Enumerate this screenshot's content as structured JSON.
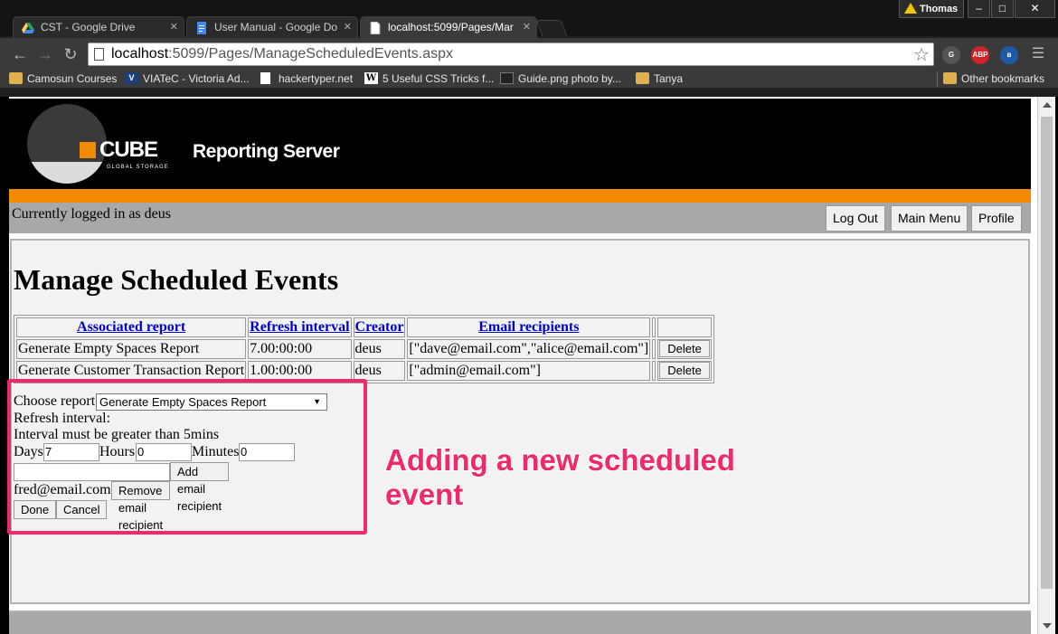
{
  "browser": {
    "tabs": [
      {
        "title": "CST - Google Drive",
        "icon": "google-drive-icon"
      },
      {
        "title": "User Manual - Google Do",
        "icon": "google-docs-icon"
      },
      {
        "title": "localhost:5099/Pages/Mar",
        "icon": "page-icon",
        "active": true
      }
    ],
    "profile_name": "Thomas",
    "window_controls": {
      "minimize": "–",
      "maximize": "□",
      "close": "✕"
    },
    "url_host": "localhost",
    "url_rest": ":5099/Pages/ManageScheduledEvents.aspx",
    "extensions": [
      {
        "name": "ghostery-icon",
        "label": "G",
        "color": "#555555"
      },
      {
        "name": "adblock-plus-icon",
        "label": "ABP",
        "color": "#d2232a"
      },
      {
        "name": "bluetooth-icon",
        "label": "ʙ",
        "color": "#1e5aa8"
      }
    ],
    "bookmarks": [
      {
        "label": "Camosun Courses",
        "icon": "folder-icon"
      },
      {
        "label": "VIATeC - Victoria Ad...",
        "icon": "viatec-icon"
      },
      {
        "label": "hackertyper.net",
        "icon": "page-icon"
      },
      {
        "label": "5 Useful CSS Tricks f...",
        "icon": "w-icon"
      },
      {
        "label": "Guide.png photo by...",
        "icon": "image-icon"
      },
      {
        "label": "Tanya",
        "icon": "folder-icon"
      }
    ],
    "other_bookmarks": "Other bookmarks"
  },
  "site": {
    "brand": "CUBE",
    "brand_tagline": "GLOBAL STORAGE",
    "product": "Reporting Server",
    "accent_color": "#f58a00",
    "logged_in_text": "Currently logged in as deus",
    "nav": {
      "logout": "Log Out",
      "main_menu": "Main Menu",
      "profile": "Profile"
    }
  },
  "page": {
    "title": "Manage Scheduled Events",
    "table": {
      "headers": [
        "Associated report",
        "Refresh interval",
        "Creator",
        "Email recipients"
      ],
      "rows": [
        {
          "report": "Generate Empty Spaces Report",
          "interval": "7.00:00:00",
          "creator": "deus",
          "recipients": "[\"dave@email.com\",\"alice@email.com\"]",
          "action": "Delete"
        },
        {
          "report": "Generate Customer Transaction Report",
          "interval": "1.00:00:00",
          "creator": "deus",
          "recipients": "[\"admin@email.com\"]",
          "action": "Delete"
        }
      ]
    },
    "form": {
      "choose_report_label": "Choose report",
      "selected_report": "Generate Empty Spaces Report",
      "refresh_label": "Refresh interval:",
      "interval_note": "Interval must be greater than 5mins",
      "days_label": "Days",
      "days_value": "7",
      "hours_label": "Hours",
      "hours_value": "0",
      "minutes_label": "Minutes",
      "minutes_value": "0",
      "email_value": "",
      "add_email_label": "Add email recipient",
      "existing_recipient": "fred@email.com",
      "remove_email_label": "Remove email recipient",
      "done_label": "Done",
      "cancel_label": "Cancel"
    }
  },
  "annotation": {
    "line1": "Adding a new scheduled",
    "line2": "event",
    "color": "#ee2a6a"
  }
}
